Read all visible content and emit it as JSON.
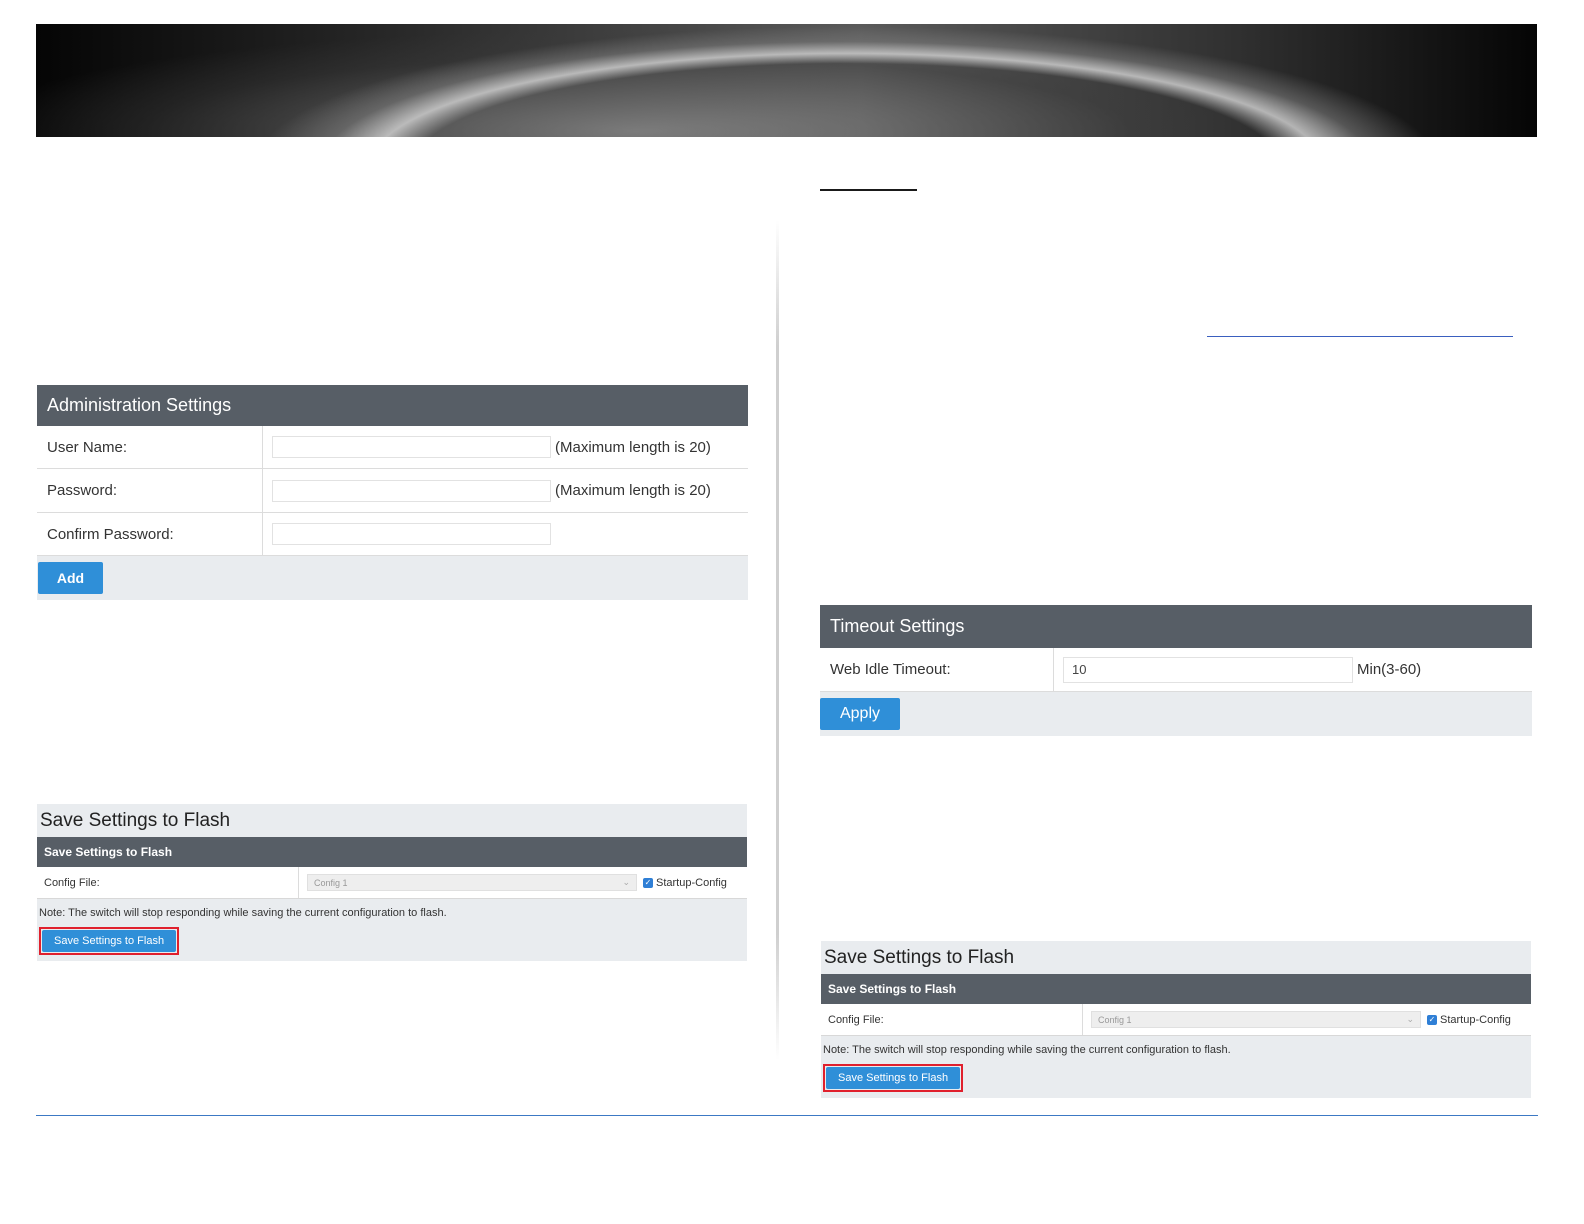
{
  "admin_settings": {
    "title": "Administration Settings",
    "rows": [
      {
        "label": "User Name:",
        "value": "",
        "hint": "(Maximum length is 20)"
      },
      {
        "label": "Password:",
        "value": "",
        "hint": "(Maximum length is 20)"
      },
      {
        "label": "Confirm Password:",
        "value": "",
        "hint": ""
      }
    ],
    "add_label": "Add"
  },
  "timeout_settings": {
    "title": "Timeout Settings",
    "label": "Web Idle Timeout:",
    "value": "10",
    "hint": "Min(3-60)",
    "apply_label": "Apply"
  },
  "flash_left": {
    "title": "Save Settings to Flash",
    "header": "Save Settings to Flash",
    "config_label": "Config File:",
    "config_value": "Config 1",
    "checkbox_label": "Startup-Config",
    "checked": true,
    "note": "Note: The switch will stop responding while saving the current configuration to flash.",
    "button_label": "Save Settings to Flash"
  },
  "flash_right": {
    "title": "Save Settings to Flash",
    "header": "Save Settings to Flash",
    "config_label": "Config File:",
    "config_value": "Config 1",
    "checkbox_label": "Startup-Config",
    "checked": true,
    "note": "Note: The switch will stop responding while saving the current configuration to flash.",
    "button_label": "Save Settings to Flash"
  },
  "colors": {
    "panel_header": "#575e66",
    "button_blue": "#2f8fd8",
    "highlight_red": "#e0202d",
    "footer_line": "#3c79c4"
  }
}
